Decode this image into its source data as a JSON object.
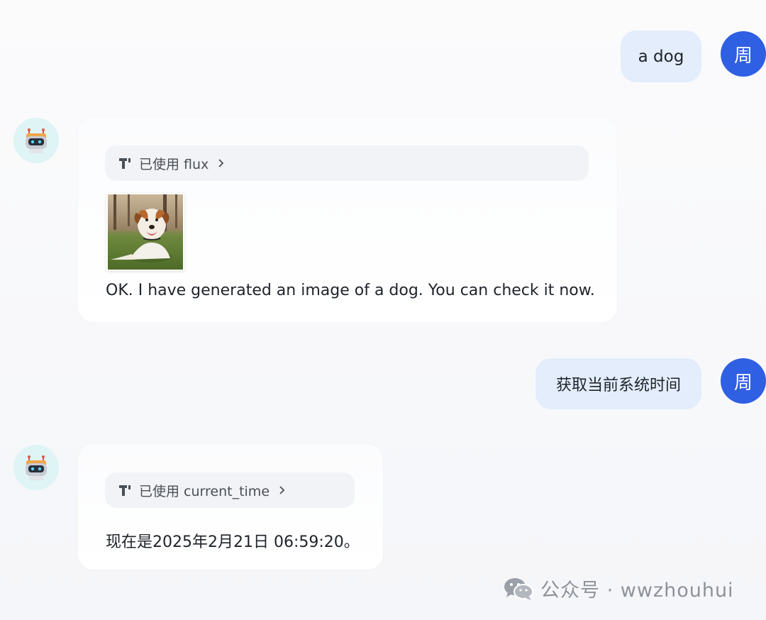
{
  "user": {
    "avatar_char": "周",
    "messages": [
      "a dog",
      "获取当前系统时间"
    ]
  },
  "bot": {
    "messages": [
      {
        "tool_label": "已使用 flux",
        "image_alt": "generated image of a dog lying on grass",
        "text": "OK. I have generated an image of a dog. You can check it now."
      },
      {
        "tool_label": "已使用 current_time",
        "text": "现在是2025年2月21日 06:59:20。"
      }
    ]
  },
  "watermark": {
    "text": "公众号 · wwzhouhui"
  },
  "colors": {
    "user_bubble": "#e3edfb",
    "user_avatar": "#2f5fe3",
    "bot_avatar_bg": "#dff4f4",
    "chip_bg": "#f2f3f6"
  }
}
